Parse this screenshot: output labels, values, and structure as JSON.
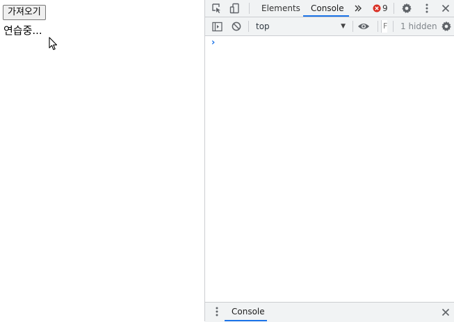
{
  "page": {
    "fetch_button_label": "가져오기",
    "status_text": "연습중..."
  },
  "devtools": {
    "tabs": [
      {
        "label": "Elements",
        "active": false
      },
      {
        "label": "Console",
        "active": true
      }
    ],
    "more_tabs_icon": "chevron-double-right-icon",
    "error_count": "9",
    "icons": {
      "inspect": "inspect-element-icon",
      "device": "device-toolbar-icon",
      "settings": "gear-icon",
      "menu": "kebab-menu-icon",
      "close": "close-icon",
      "sidebar": "sidebar-toggle-icon",
      "clear": "clear-console-icon",
      "eye": "eye-icon"
    },
    "filter": {
      "context": "top",
      "filter_placeholder": "F",
      "hidden_label": "1 hidden"
    },
    "console": {
      "prompt": "›"
    },
    "drawer": {
      "tab_label": "Console"
    },
    "colors": {
      "accent": "#1a73e8",
      "error": "#d93025",
      "toolbar_bg": "#f1f3f4",
      "border": "#cbcdd1"
    }
  }
}
